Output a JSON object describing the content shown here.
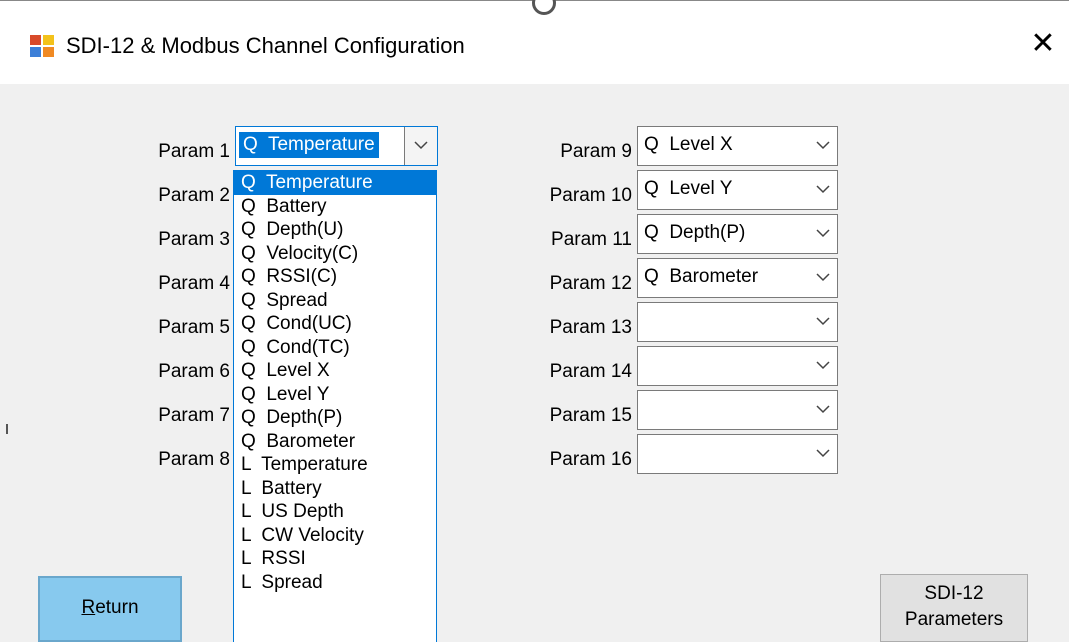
{
  "window": {
    "title": "SDI-12 & Modbus Channel Configuration",
    "close_glyph": "✕"
  },
  "params_left": [
    {
      "label": "Param 1",
      "value": "Q  Temperature"
    },
    {
      "label": "Param 2",
      "value": ""
    },
    {
      "label": "Param 3",
      "value": ""
    },
    {
      "label": "Param 4",
      "value": ""
    },
    {
      "label": "Param 5",
      "value": ""
    },
    {
      "label": "Param 6",
      "value": ""
    },
    {
      "label": "Param 7",
      "value": ""
    },
    {
      "label": "Param 8",
      "value": ""
    }
  ],
  "params_right": [
    {
      "label": "Param 9",
      "value": "Q  Level X"
    },
    {
      "label": "Param 10",
      "value": "Q  Level Y"
    },
    {
      "label": "Param 11",
      "value": "Q  Depth(P)"
    },
    {
      "label": "Param 12",
      "value": "Q  Barometer"
    },
    {
      "label": "Param 13",
      "value": ""
    },
    {
      "label": "Param 14",
      "value": ""
    },
    {
      "label": "Param 15",
      "value": ""
    },
    {
      "label": "Param 16",
      "value": ""
    }
  ],
  "dropdown_options": [
    "Q  Temperature",
    "Q  Battery",
    "Q  Depth(U)",
    "Q  Velocity(C)",
    "Q  RSSI(C)",
    "Q  Spread",
    "Q  Cond(UC)",
    "Q  Cond(TC)",
    "Q  Level X",
    "Q  Level Y",
    "Q  Depth(P)",
    "Q  Barometer",
    "L  Temperature",
    "L  Battery",
    "L  US Depth",
    "L  CW Velocity",
    "L  RSSI",
    "L  Spread"
  ],
  "dropdown_selected_index": 0,
  "buttons": {
    "return_first": "R",
    "return_rest": "eturn",
    "sdi_line1": "SDI-12",
    "sdi_line2": "Parameters"
  },
  "colors": {
    "accent": "#0078d7",
    "return_button": "#87c9ee",
    "dialog_bg": "#f0f0f0"
  }
}
